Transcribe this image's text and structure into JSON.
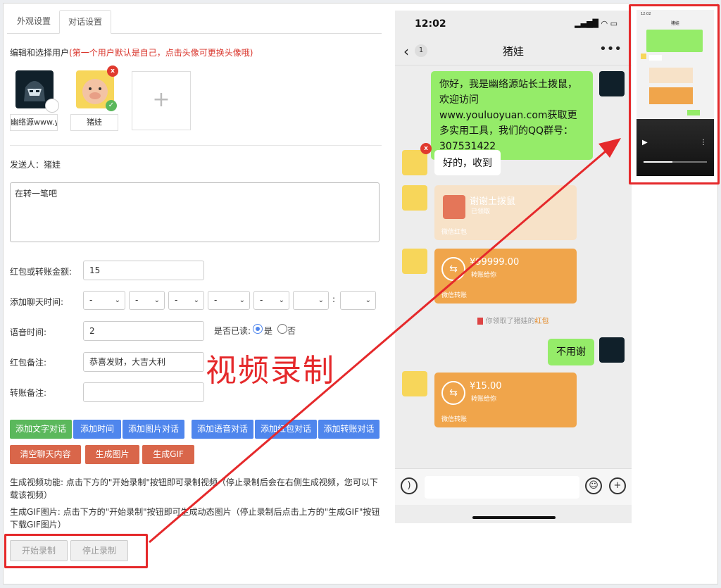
{
  "tabs": [
    "外观设置",
    "对话设置"
  ],
  "hint": {
    "prefix": "编辑和选择用户",
    "note": "(第一个用户默认是自己，点击头像可更换头像哦)"
  },
  "users": [
    {
      "name": "幽络源www.yo"
    },
    {
      "name": "猪娃"
    }
  ],
  "add_user": "+",
  "sender": "发送人：猪娃",
  "message_text": "在转一笔吧",
  "form": {
    "amount_label": "红包或转账金额:",
    "amount_value": "15",
    "time_label": "添加聊天时间:",
    "time_selects": [
      "-",
      "-",
      "-",
      "-",
      "-",
      "",
      ""
    ],
    "time_colon": ":",
    "voice_label": "语音时间:",
    "voice_value": "2",
    "read_label": "是否已读:",
    "read_yes": "是",
    "read_no": "否",
    "redpacket_note_label": "红包备注:",
    "redpacket_note_value": "恭喜发财，大吉大利",
    "transfer_note_label": "转账备注:",
    "transfer_note_value": ""
  },
  "buttons": {
    "add_text": "添加文字对话",
    "add_time": "添加时间",
    "add_image": "添加图片对话",
    "add_voice": "添加语音对话",
    "add_redpacket": "添加红包对话",
    "add_transfer": "添加转账对话",
    "clear": "清空聊天内容",
    "gen_image": "生成图片",
    "gen_gif": "生成GIF",
    "start_record": "开始录制",
    "stop_record": "停止录制"
  },
  "desc_video": "生成视频功能: 点击下方的\"开始录制\"按钮即可录制视频（停止录制后会在右侧生成视频，您可以下载该视频）",
  "desc_gif": "生成GIF图片: 点击下方的\"开始录制\"按钮即可生成动态图片（停止录制后点击上方的\"生成GIF\"按钮下载GIF图片）",
  "annotation": "视频录制",
  "phone": {
    "time": "12:02",
    "unread": "1",
    "title": "猪娃",
    "msg1": "你好，我是幽络源站长土拨鼠，欢迎访问www.youluoyuan.com获取更多实用工具，我们的QQ群号：307531422",
    "msg2": "好的，收到",
    "rp1_title": "谢谢土拨鼠",
    "rp1_status": "已领取",
    "rp1_footer": "微信红包",
    "tr1_amount": "¥99999.00",
    "tr1_status": "转账给你",
    "tr1_footer": "微信转账",
    "sys_prefix": "你领取了猪娃的",
    "sys_red": "红包",
    "msg3": "不用谢",
    "tr2_amount": "¥15.00",
    "tr2_status": "转账给你",
    "tr2_footer": "微信转账"
  },
  "preview": {
    "title": "猪娃",
    "time": "12:02"
  },
  "colors": {
    "accent_red": "#e5292b",
    "wechat_green": "#95ec69",
    "transfer_orange": "#f0a54b",
    "btn_blue": "#4f86ed",
    "btn_green": "#5bb85c",
    "btn_orange": "#d9664a"
  }
}
